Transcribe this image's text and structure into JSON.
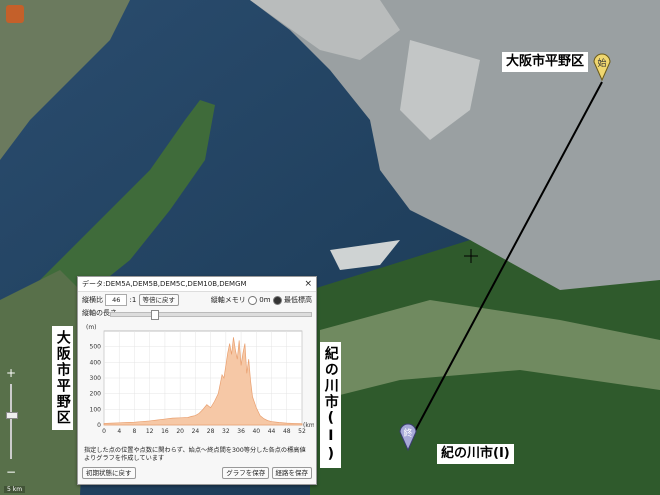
{
  "map": {
    "start_label": "大阪市平野区",
    "end_label": "紀の川市(Ⅰ)",
    "left_vertical_label": "大阪市平野区",
    "right_vertical_label": "紀の川市(Ⅰ)",
    "start_pin": "始",
    "end_pin": "終",
    "scale": "5 km"
  },
  "profile_window": {
    "title": "データ:DEM5A,DEM5B,DEM5C,DEM10B,DEMGM",
    "close": "×",
    "ratio_label": "縦横比",
    "ratio_value": "46",
    "ratio_suffix": ":1",
    "equal_button": "等倍に戻す",
    "mem_label": "縦軸メモリ",
    "radio_zero": "0m",
    "radio_min": "最低標高",
    "length_label": "縦軸の長さ",
    "note": "指定した点の位置や点数に関わらず、始点～終点間を300等分した各点の標高値よりグラフを作成しています",
    "reset_button": "初期状態に戻す",
    "save_graph_button": "グラフを保存",
    "save_path_button": "経路を保存"
  },
  "chart_data": {
    "type": "area",
    "xlabel": "(km)",
    "ylabel": "(m)",
    "xlim": [
      0,
      52
    ],
    "ylim": [
      0,
      600
    ],
    "x_ticks": [
      0,
      4,
      8,
      12,
      16,
      20,
      24,
      28,
      32,
      36,
      40,
      44,
      48,
      52
    ],
    "y_ticks": [
      0,
      100,
      200,
      300,
      400,
      500
    ],
    "series": [
      {
        "x": [
          0,
          2,
          4,
          6,
          8,
          10,
          12,
          14,
          16,
          18,
          20,
          22,
          23,
          24,
          25,
          26,
          27,
          28,
          29,
          30,
          30.5,
          31,
          31.5,
          32,
          32.5,
          33,
          33.5,
          34,
          34.5,
          35,
          35.5,
          36,
          36.5,
          37,
          37.5,
          38,
          38.5,
          39,
          40,
          41,
          42,
          43,
          44,
          46,
          48,
          50,
          52
        ],
        "y": [
          10,
          12,
          14,
          16,
          18,
          22,
          26,
          32,
          38,
          44,
          46,
          48,
          55,
          60,
          75,
          100,
          130,
          110,
          150,
          200,
          260,
          320,
          300,
          380,
          460,
          520,
          450,
          560,
          480,
          420,
          540,
          380,
          460,
          520,
          330,
          420,
          280,
          180,
          110,
          60,
          40,
          28,
          22,
          16,
          12,
          10,
          8
        ]
      }
    ],
    "fill": "#f6c8a6",
    "stroke": "#e9a070"
  },
  "zoom": {
    "plus": "+",
    "minus": "−"
  }
}
